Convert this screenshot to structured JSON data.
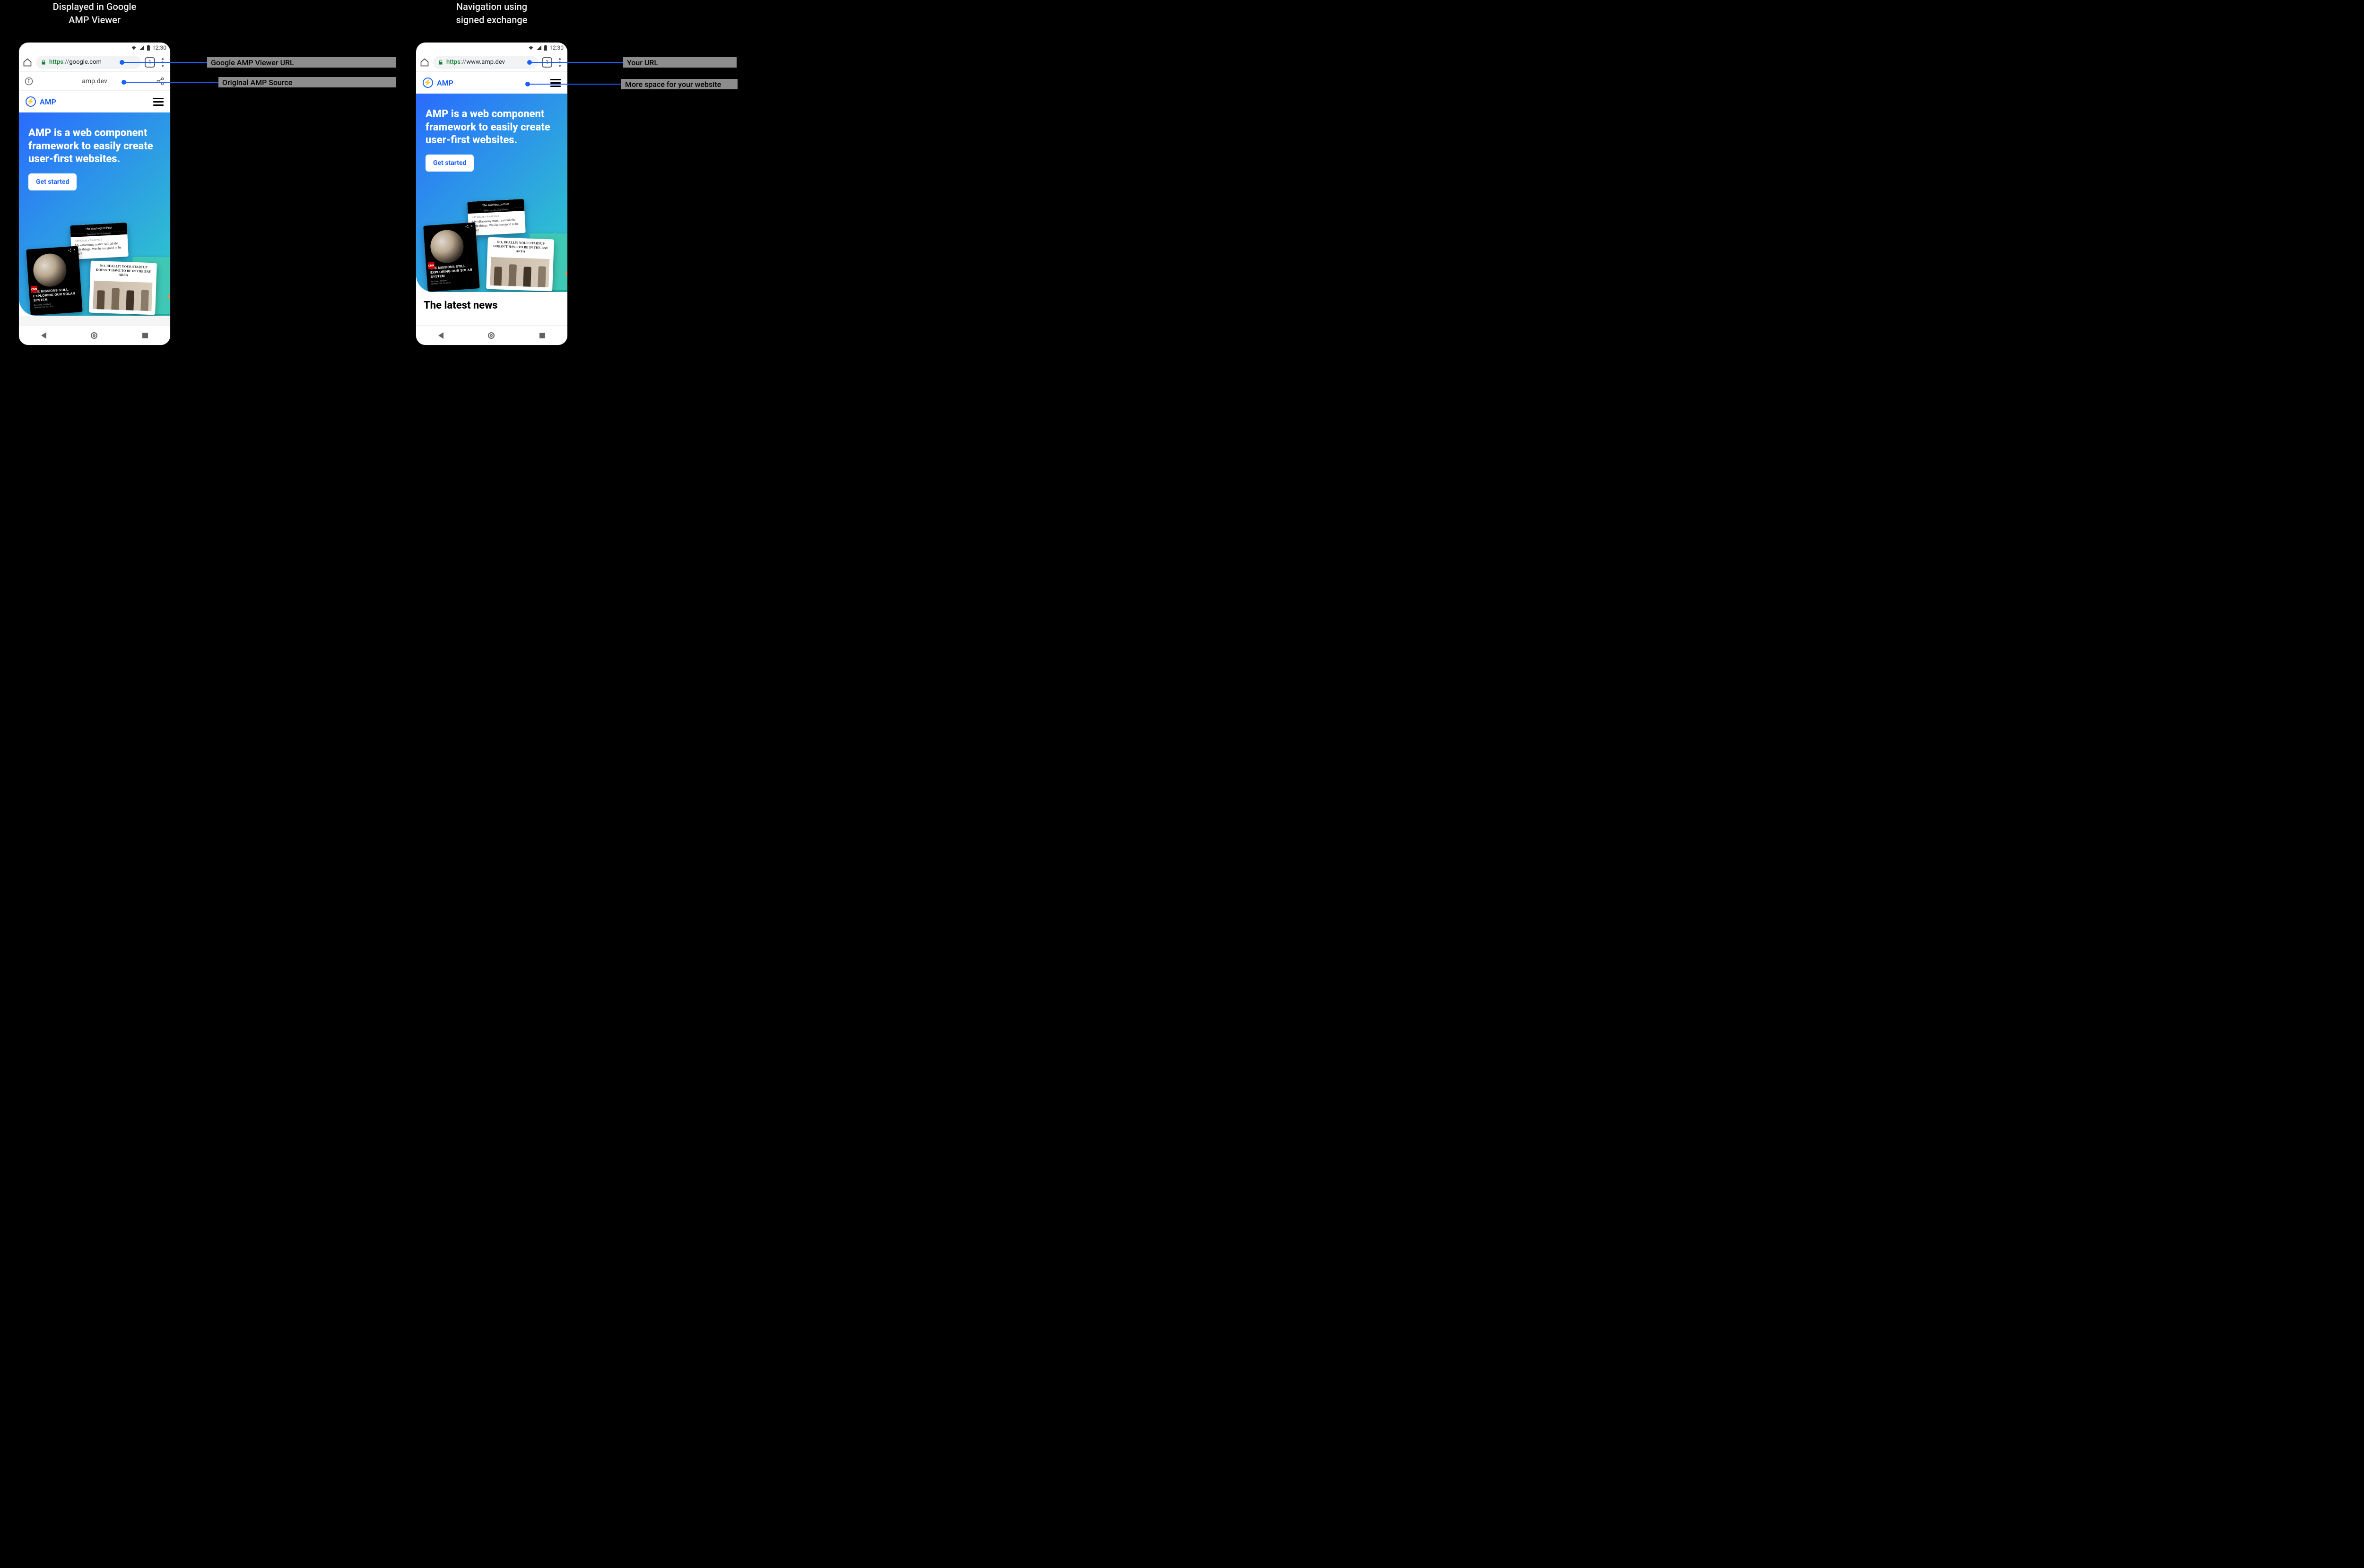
{
  "left": {
    "title": "Displayed in Google\nAMP Viewer",
    "statusbar": {
      "time": "12:30"
    },
    "toolbar": {
      "url_https": "https",
      "url_sep": "://",
      "url_domain": "google.com",
      "tab_count": "1"
    },
    "amp_source_bar": {
      "label": "amp.dev"
    },
    "logo": {
      "text": "AMP"
    },
    "hero": {
      "headline": "AMP is a web component framework to easily create user-first websites.",
      "cta": "Get started"
    },
    "collage": {
      "wapo_header": "The Washington Post",
      "wapo_sub": "Democracy Dies in Darkness",
      "wapo_meta": "National • Analysis",
      "wapo_text": "My eHarmony match said all the right things. Was he too good to be true?",
      "cnn_title": "THE MISSIONS STILL EXPLORING OUR SOLAR SYSTEM",
      "cnn_byline": "By Ashley Strickland\nUpdated Feb. 12, 2019",
      "startup_title": "NO, REALLY! YOUR STARTUP DOESN'T HAVE TO BE IN THE BAY AREA"
    },
    "annotations": {
      "url": "Google AMP Viewer URL",
      "source": "Original AMP Source"
    }
  },
  "right": {
    "title": "Navigation using\nsigned exchange",
    "statusbar": {
      "time": "12:30"
    },
    "toolbar": {
      "url_https": "https",
      "url_sep": "://",
      "url_domain": "www.amp.dev",
      "tab_count": "1"
    },
    "logo": {
      "text": "AMP"
    },
    "hero": {
      "headline": "AMP is a web component framework to easily create user-first websites.",
      "cta": "Get started"
    },
    "collage": {
      "wapo_header": "The Washington Post",
      "wapo_sub": "Democracy Dies in Darkness",
      "wapo_meta": "National • Analysis",
      "wapo_text": "My eHarmony match said all the right things. Was he too good to be true?",
      "cnn_title": "THE MISSIONS STILL EXPLORING OUR SOLAR SYSTEM",
      "cnn_byline": "By Ashley Strickland\nUpdated Feb. 12, 2019",
      "startup_title": "NO, REALLY! YOUR STARTUP DOESN'T HAVE TO BE IN THE BAY AREA"
    },
    "latest_news": "The latest news",
    "annotations": {
      "url": "Your URL",
      "space": "More space for your website"
    }
  }
}
